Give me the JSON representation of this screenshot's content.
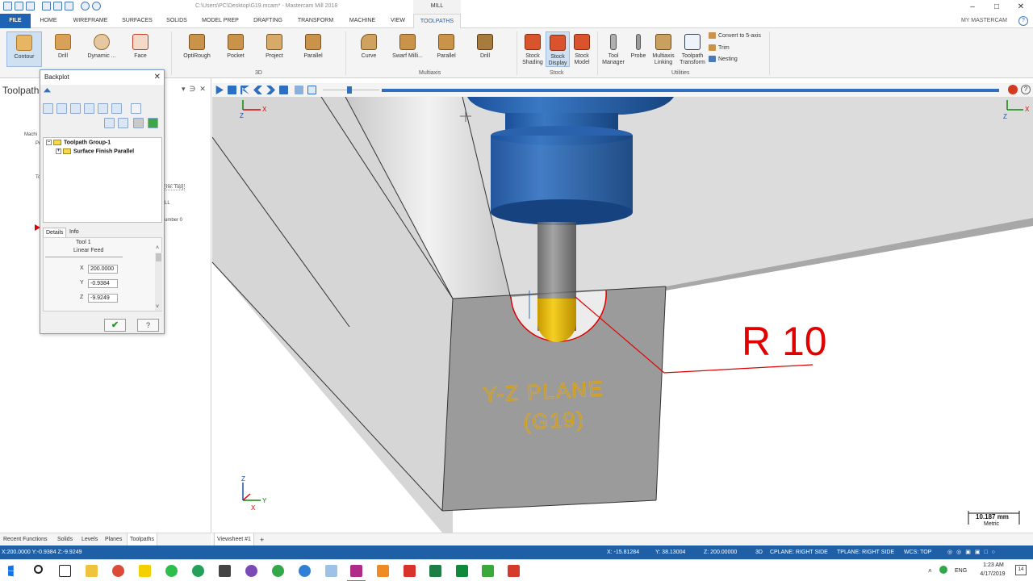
{
  "window": {
    "title": "C:\\Users\\PC\\Desktop\\G19.mcam* - Mastercam Mill 2018",
    "context_tab": "MILL",
    "controls": [
      "minimize",
      "maximize",
      "close"
    ]
  },
  "ribbon_tabs": [
    "FILE",
    "HOME",
    "WIREFRAME",
    "SURFACES",
    "SOLIDS",
    "MODEL PREP",
    "DRAFTING",
    "TRANSFORM",
    "MACHINE",
    "VIEW",
    "TOOLPATHS"
  ],
  "active_tab": "TOOLPATHS",
  "my_mastercam": "MY MASTERCAM",
  "ribbon": {
    "group_2d": [
      {
        "label": "Contour",
        "icon": "contour-icon"
      },
      {
        "label": "Drill",
        "icon": "drill-icon"
      },
      {
        "label": "Dynamic ...",
        "icon": "dynamic-icon"
      },
      {
        "label": "Face",
        "icon": "face-icon"
      }
    ],
    "group_3d": {
      "label": "3D",
      "buttons": [
        {
          "label": "OptiRough",
          "icon": "optirough-icon"
        },
        {
          "label": "Pocket",
          "icon": "pocket-icon"
        },
        {
          "label": "Project",
          "icon": "project-icon"
        },
        {
          "label": "Parallel",
          "icon": "parallel-icon"
        }
      ]
    },
    "group_multiaxis": {
      "label": "Multiaxis",
      "buttons": [
        {
          "label": "Curve",
          "icon": "curve-icon"
        },
        {
          "label": "Swarf Milli...",
          "icon": "swarf-icon"
        },
        {
          "label": "Parallel",
          "icon": "parallel-icon"
        },
        {
          "label": "Drill",
          "icon": "drill-icon"
        }
      ]
    },
    "group_stock": {
      "label": "Stock",
      "buttons": [
        {
          "label1": "Stock",
          "label2": "Shading",
          "icon": "stock-shading-icon"
        },
        {
          "label1": "Stock",
          "label2": "Display",
          "icon": "stock-display-icon"
        },
        {
          "label1": "Stock",
          "label2": "Model",
          "icon": "stock-model-icon"
        }
      ]
    },
    "group_utilities": {
      "label": "Utilities",
      "buttons": [
        {
          "label1": "Tool",
          "label2": "Manager",
          "icon": "tool-manager-icon"
        },
        {
          "label1": "Probe",
          "label2": "",
          "icon": "probe-icon"
        },
        {
          "label1": "Multiaxis",
          "label2": "Linking",
          "icon": "multiaxis-linking-icon"
        },
        {
          "label1": "Toolpath",
          "label2": "Transform",
          "icon": "toolpath-transform-icon"
        }
      ],
      "small_buttons": [
        "Convert to 5-axis",
        "Trim",
        "Nesting"
      ]
    }
  },
  "manager": {
    "title": "Toolpath",
    "fragments": [
      "Machi",
      "Pr",
      "To",
      "ne: Top]",
      "LL",
      "umber 0"
    ]
  },
  "backplot": {
    "title": "Backplot",
    "tree": {
      "group": "Toolpath Group-1",
      "operation": "Surface Finish Parallel"
    },
    "tabs": [
      "Details",
      "Info"
    ],
    "details": {
      "tool": "Tool 1",
      "move": "Linear Feed",
      "x_label": "X",
      "x": "200.0000",
      "y_label": "Y",
      "y": "-0.9384",
      "z_label": "Z",
      "z": "-9.9249"
    }
  },
  "viewport": {
    "annotation_radius": "R 10",
    "plane_label_line1": "Y-Z PLANE",
    "plane_label_line2": "(G19)",
    "scale_value": "10.187 mm",
    "scale_unit": "Metric",
    "axis_labels": {
      "x": "X",
      "y": "Y",
      "z": "Z"
    },
    "colors": {
      "stock": "#9a9a9a",
      "holder": "#1e5aa8",
      "tool_tip": "#e8c21a",
      "path": "#e00000",
      "plane_text": "#d9a520"
    }
  },
  "bottom_tabs": [
    "Recent Functions",
    "Solids",
    "Levels",
    "Planes",
    "Toolpaths"
  ],
  "active_bottom_tab": "Toolpaths",
  "viewsheet": "Viewsheet #1",
  "status": {
    "left_coords": "X:200.0000   Y:-0.9384   Z:-9.9249",
    "x": "X:    -15.81284",
    "y": "Y:    38.13004",
    "z": "Z:    200.00000",
    "mode": "3D",
    "cplane": "CPLANE: RIGHT SIDE",
    "tplane": "TPLANE: RIGHT SIDE",
    "wcs": "WCS: TOP"
  },
  "taskbar": {
    "language": "ENG",
    "time": "1:23 AM",
    "date": "4/17/2019",
    "notifications": "14"
  }
}
